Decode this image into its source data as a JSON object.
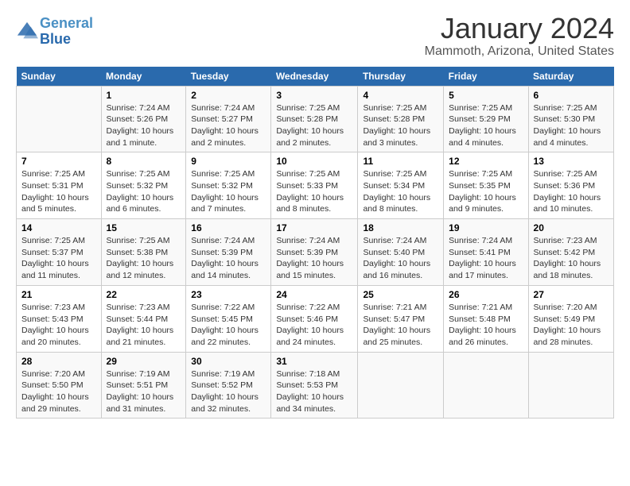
{
  "header": {
    "logo_line1": "General",
    "logo_line2": "Blue",
    "title": "January 2024",
    "subtitle": "Mammoth, Arizona, United States"
  },
  "calendar": {
    "days_of_week": [
      "Sunday",
      "Monday",
      "Tuesday",
      "Wednesday",
      "Thursday",
      "Friday",
      "Saturday"
    ],
    "weeks": [
      [
        {
          "day": "",
          "sunrise": "",
          "sunset": "",
          "daylight": ""
        },
        {
          "day": "1",
          "sunrise": "Sunrise: 7:24 AM",
          "sunset": "Sunset: 5:26 PM",
          "daylight": "Daylight: 10 hours and 1 minute."
        },
        {
          "day": "2",
          "sunrise": "Sunrise: 7:24 AM",
          "sunset": "Sunset: 5:27 PM",
          "daylight": "Daylight: 10 hours and 2 minutes."
        },
        {
          "day": "3",
          "sunrise": "Sunrise: 7:25 AM",
          "sunset": "Sunset: 5:28 PM",
          "daylight": "Daylight: 10 hours and 2 minutes."
        },
        {
          "day": "4",
          "sunrise": "Sunrise: 7:25 AM",
          "sunset": "Sunset: 5:28 PM",
          "daylight": "Daylight: 10 hours and 3 minutes."
        },
        {
          "day": "5",
          "sunrise": "Sunrise: 7:25 AM",
          "sunset": "Sunset: 5:29 PM",
          "daylight": "Daylight: 10 hours and 4 minutes."
        },
        {
          "day": "6",
          "sunrise": "Sunrise: 7:25 AM",
          "sunset": "Sunset: 5:30 PM",
          "daylight": "Daylight: 10 hours and 4 minutes."
        }
      ],
      [
        {
          "day": "7",
          "sunrise": "Sunrise: 7:25 AM",
          "sunset": "Sunset: 5:31 PM",
          "daylight": "Daylight: 10 hours and 5 minutes."
        },
        {
          "day": "8",
          "sunrise": "Sunrise: 7:25 AM",
          "sunset": "Sunset: 5:32 PM",
          "daylight": "Daylight: 10 hours and 6 minutes."
        },
        {
          "day": "9",
          "sunrise": "Sunrise: 7:25 AM",
          "sunset": "Sunset: 5:32 PM",
          "daylight": "Daylight: 10 hours and 7 minutes."
        },
        {
          "day": "10",
          "sunrise": "Sunrise: 7:25 AM",
          "sunset": "Sunset: 5:33 PM",
          "daylight": "Daylight: 10 hours and 8 minutes."
        },
        {
          "day": "11",
          "sunrise": "Sunrise: 7:25 AM",
          "sunset": "Sunset: 5:34 PM",
          "daylight": "Daylight: 10 hours and 8 minutes."
        },
        {
          "day": "12",
          "sunrise": "Sunrise: 7:25 AM",
          "sunset": "Sunset: 5:35 PM",
          "daylight": "Daylight: 10 hours and 9 minutes."
        },
        {
          "day": "13",
          "sunrise": "Sunrise: 7:25 AM",
          "sunset": "Sunset: 5:36 PM",
          "daylight": "Daylight: 10 hours and 10 minutes."
        }
      ],
      [
        {
          "day": "14",
          "sunrise": "Sunrise: 7:25 AM",
          "sunset": "Sunset: 5:37 PM",
          "daylight": "Daylight: 10 hours and 11 minutes."
        },
        {
          "day": "15",
          "sunrise": "Sunrise: 7:25 AM",
          "sunset": "Sunset: 5:38 PM",
          "daylight": "Daylight: 10 hours and 12 minutes."
        },
        {
          "day": "16",
          "sunrise": "Sunrise: 7:24 AM",
          "sunset": "Sunset: 5:39 PM",
          "daylight": "Daylight: 10 hours and 14 minutes."
        },
        {
          "day": "17",
          "sunrise": "Sunrise: 7:24 AM",
          "sunset": "Sunset: 5:39 PM",
          "daylight": "Daylight: 10 hours and 15 minutes."
        },
        {
          "day": "18",
          "sunrise": "Sunrise: 7:24 AM",
          "sunset": "Sunset: 5:40 PM",
          "daylight": "Daylight: 10 hours and 16 minutes."
        },
        {
          "day": "19",
          "sunrise": "Sunrise: 7:24 AM",
          "sunset": "Sunset: 5:41 PM",
          "daylight": "Daylight: 10 hours and 17 minutes."
        },
        {
          "day": "20",
          "sunrise": "Sunrise: 7:23 AM",
          "sunset": "Sunset: 5:42 PM",
          "daylight": "Daylight: 10 hours and 18 minutes."
        }
      ],
      [
        {
          "day": "21",
          "sunrise": "Sunrise: 7:23 AM",
          "sunset": "Sunset: 5:43 PM",
          "daylight": "Daylight: 10 hours and 20 minutes."
        },
        {
          "day": "22",
          "sunrise": "Sunrise: 7:23 AM",
          "sunset": "Sunset: 5:44 PM",
          "daylight": "Daylight: 10 hours and 21 minutes."
        },
        {
          "day": "23",
          "sunrise": "Sunrise: 7:22 AM",
          "sunset": "Sunset: 5:45 PM",
          "daylight": "Daylight: 10 hours and 22 minutes."
        },
        {
          "day": "24",
          "sunrise": "Sunrise: 7:22 AM",
          "sunset": "Sunset: 5:46 PM",
          "daylight": "Daylight: 10 hours and 24 minutes."
        },
        {
          "day": "25",
          "sunrise": "Sunrise: 7:21 AM",
          "sunset": "Sunset: 5:47 PM",
          "daylight": "Daylight: 10 hours and 25 minutes."
        },
        {
          "day": "26",
          "sunrise": "Sunrise: 7:21 AM",
          "sunset": "Sunset: 5:48 PM",
          "daylight": "Daylight: 10 hours and 26 minutes."
        },
        {
          "day": "27",
          "sunrise": "Sunrise: 7:20 AM",
          "sunset": "Sunset: 5:49 PM",
          "daylight": "Daylight: 10 hours and 28 minutes."
        }
      ],
      [
        {
          "day": "28",
          "sunrise": "Sunrise: 7:20 AM",
          "sunset": "Sunset: 5:50 PM",
          "daylight": "Daylight: 10 hours and 29 minutes."
        },
        {
          "day": "29",
          "sunrise": "Sunrise: 7:19 AM",
          "sunset": "Sunset: 5:51 PM",
          "daylight": "Daylight: 10 hours and 31 minutes."
        },
        {
          "day": "30",
          "sunrise": "Sunrise: 7:19 AM",
          "sunset": "Sunset: 5:52 PM",
          "daylight": "Daylight: 10 hours and 32 minutes."
        },
        {
          "day": "31",
          "sunrise": "Sunrise: 7:18 AM",
          "sunset": "Sunset: 5:53 PM",
          "daylight": "Daylight: 10 hours and 34 minutes."
        },
        {
          "day": "",
          "sunrise": "",
          "sunset": "",
          "daylight": ""
        },
        {
          "day": "",
          "sunrise": "",
          "sunset": "",
          "daylight": ""
        },
        {
          "day": "",
          "sunrise": "",
          "sunset": "",
          "daylight": ""
        }
      ]
    ]
  }
}
